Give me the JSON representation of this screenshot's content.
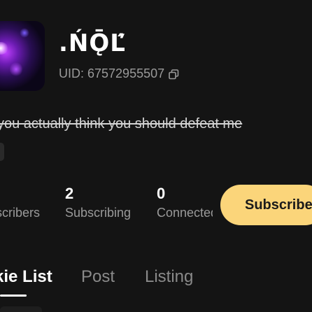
{
  "profile": {
    "username": ".ŃǬĽ́",
    "uid": "UID: 67572955507",
    "bio": "you actually think you should defeat me"
  },
  "stats": {
    "subscribers_label": "scribers",
    "subscribing_count": "2",
    "subscribing_label": "Subscribing",
    "connected_count": "0",
    "connected_label": "Connected"
  },
  "actions": {
    "subscribe_label": "Subscribe"
  },
  "tabs": [
    {
      "label": "kie List",
      "active": true
    },
    {
      "label": "Post",
      "active": false
    },
    {
      "label": "Listing",
      "active": false
    }
  ],
  "colors": {
    "background": "#141414",
    "accent": "#fbd57a",
    "muted_text": "#9a9a9a"
  },
  "icons": {
    "copy": "copy-icon"
  }
}
